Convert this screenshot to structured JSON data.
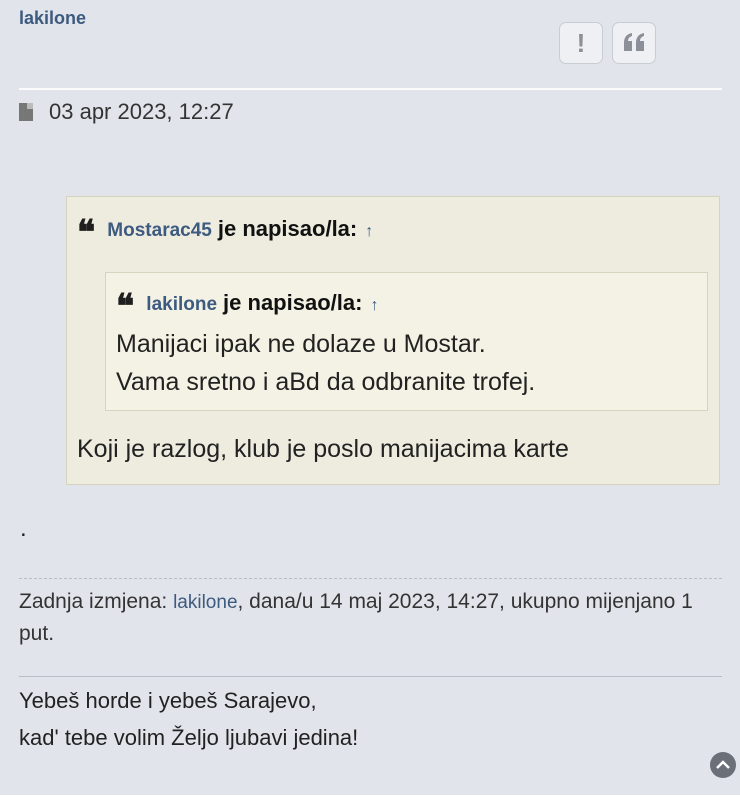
{
  "post": {
    "author": "lakilone",
    "date": "03 apr 2023, 12:27",
    "actions": {
      "report_icon": "!",
      "quote_icon": "quote-icon"
    }
  },
  "quote_outer": {
    "user": "Mostarac45",
    "wrote": "je napisao/la:",
    "arrow": "↑",
    "text": "Koji je razlog, klub je poslo manijacima karte"
  },
  "quote_inner": {
    "user": "lakilone",
    "wrote": "je napisao/la:",
    "arrow": "↑",
    "line1": "Manijaci ipak ne dolaze u Mostar.",
    "line2": "Vama sretno i aBd da odbranite trofej."
  },
  "body_text": ".",
  "edit_note": {
    "prefix": "Zadnja izmjena: ",
    "user": "lakilone",
    "suffix": ", dana/u 14 maj 2023, 14:27, ukupno mijenjano 1 put."
  },
  "signature": {
    "line1": "Yebeš horde i yebeš Sarajevo,",
    "line2": "kad' tebe volim Željo ljubavi jedina!"
  }
}
